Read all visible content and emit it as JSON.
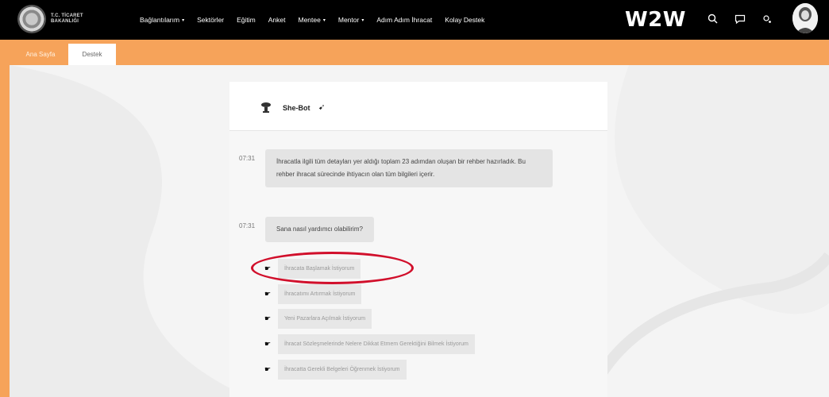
{
  "logo": {
    "text_line1": "T.C. TİCARET",
    "text_line2": "BAKANLIĞI"
  },
  "nav": {
    "items": [
      {
        "label": "Bağlantılarım",
        "dropdown": true
      },
      {
        "label": "Sektörler",
        "dropdown": false
      },
      {
        "label": "Eğitim",
        "dropdown": false
      },
      {
        "label": "Anket",
        "dropdown": false
      },
      {
        "label": "Mentee",
        "dropdown": true
      },
      {
        "label": "Mentor",
        "dropdown": true
      },
      {
        "label": "Adım Adım İhracat",
        "dropdown": false
      },
      {
        "label": "Kolay Destek",
        "dropdown": false
      }
    ],
    "brand": "W2W",
    "icons": [
      "search-icon",
      "chat-icon",
      "notification-icon",
      "user-avatar"
    ]
  },
  "tabs": {
    "home": "Ana Sayfa",
    "support": "Destek"
  },
  "chat": {
    "bot_name": "She-Bot",
    "messages": [
      {
        "time": "07:31",
        "text": "İhracatla ilgili tüm detayları yer aldığı toplam 23 adımdan oluşan bir rehber hazırladık. Bu rehber ihracat sürecinde ihtiyacın olan tüm bilgileri içerir."
      },
      {
        "time": "07:31",
        "text": "Sana nasıl yardımcı olabilirim?"
      }
    ],
    "options": [
      "İhracata Başlamak İstiyorum",
      "İhracatımı Artırmak İstiyorum",
      "Yeni Pazarlara Açılmak İstiyorum",
      "İhracat Sözleşmelerinde Nelere Dikkat Etmem Gerektiğini Bilmek İstiyorum",
      "İhracatta Gerekli Belgeleri Öğrenmek İstiyorum"
    ],
    "highlighted_option_index": 0
  },
  "colors": {
    "accent": "#f6a35a",
    "highlight": "#d10f2b",
    "navbar": "#000000"
  }
}
